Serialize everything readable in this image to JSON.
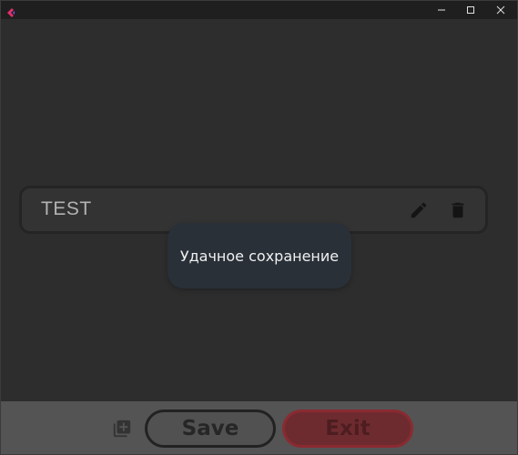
{
  "window": {
    "title": "",
    "controls": {
      "minimize_icon": "minimize-icon",
      "maximize_icon": "maximize-icon",
      "close_icon": "close-icon"
    }
  },
  "colors": {
    "background": "#2d2d2d",
    "titlebar": "#1f1f1f",
    "card": "#333333",
    "toast": "#293038",
    "bottom_bar": "#545454",
    "exit_button": "#6e2b2f",
    "app_icon_accent": "#e0306a"
  },
  "items": [
    {
      "title": "TEST",
      "edit_icon": "pencil-icon",
      "delete_icon": "trash-icon"
    }
  ],
  "toast": {
    "message": "Удачное сохранение"
  },
  "bottom_bar": {
    "add_icon": "add-to-library-icon",
    "save_label": "Save",
    "exit_label": "Exit"
  }
}
